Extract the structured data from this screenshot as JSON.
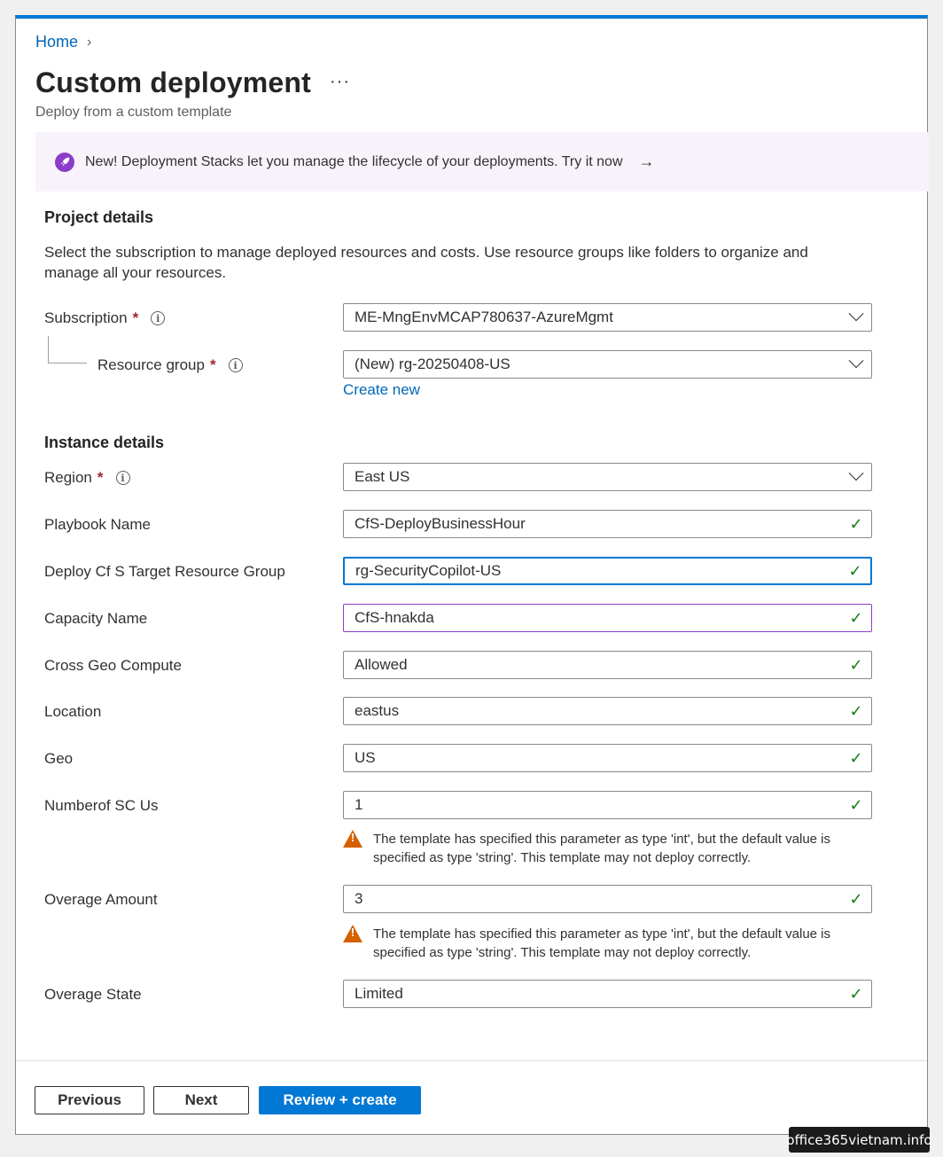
{
  "breadcrumb": {
    "home": "Home",
    "separator": "›"
  },
  "page": {
    "title": "Custom deployment",
    "more": "···",
    "subtitle": "Deploy from a custom template"
  },
  "banner": {
    "text": "New! Deployment Stacks let you manage the lifecycle of your deployments. Try it now",
    "arrow": "→",
    "icon": "rocket-icon"
  },
  "project": {
    "heading": "Project details",
    "description": "Select the subscription to manage deployed resources and costs. Use resource groups like folders to organize and manage all your resources.",
    "subscription_label": "Subscription",
    "subscription_value": "ME-MngEnvMCAP780637-AzureMgmt",
    "resource_group_label": "Resource group",
    "resource_group_value": "(New) rg-20250408-US",
    "create_new": "Create new",
    "required_mark": "*",
    "info_glyph": "i"
  },
  "instance": {
    "heading": "Instance details",
    "region_label": "Region",
    "region_value": "East US",
    "fields": [
      {
        "label": "Playbook Name",
        "value": "CfS-DeployBusinessHour"
      },
      {
        "label": "Deploy Cf S Target Resource Group",
        "value": "rg-SecurityCopilot-US"
      },
      {
        "label": "Capacity Name",
        "value": "CfS-hnakda"
      },
      {
        "label": "Cross Geo Compute",
        "value": "Allowed"
      },
      {
        "label": "Location",
        "value": "eastus"
      },
      {
        "label": "Geo",
        "value": "US"
      },
      {
        "label": "Numberof SC Us",
        "value": "1"
      },
      {
        "label": "Overage Amount",
        "value": "3"
      },
      {
        "label": "Overage State",
        "value": "Limited"
      }
    ],
    "warning_text": "The template has specified this parameter as type 'int', but the default value is specified as type 'string'. This template may not deploy correctly.",
    "check_glyph": "✓"
  },
  "footer": {
    "previous": "Previous",
    "next": "Next",
    "review_create": "Review + create"
  },
  "watermark": "office365vietnam.info",
  "colors": {
    "accent": "#0078d4",
    "success": "#107c10",
    "warning": "#d46000",
    "required": "#a4262c",
    "banner_bg": "#f8f3fb"
  }
}
